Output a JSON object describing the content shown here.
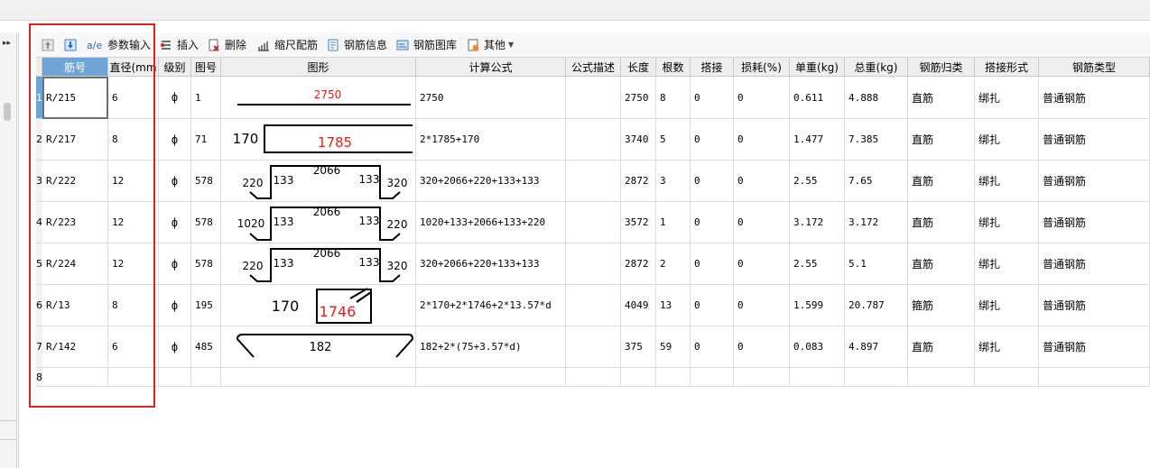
{
  "toolbar": {
    "param_input": "参数输入",
    "insert": "插入",
    "delete": "删除",
    "scale_rebar": "缩尺配筋",
    "rebar_info": "钢筋信息",
    "rebar_library": "钢筋图库",
    "other": "其他"
  },
  "columns": [
    "筋号",
    "直径(mm",
    "级别",
    "图号",
    "图形",
    "计算公式",
    "公式描述",
    "长度",
    "根数",
    "搭接",
    "损耗(%)",
    "单重(kg)",
    "总重(kg)",
    "钢筋归类",
    "搭接形式",
    "钢筋类型"
  ],
  "rows": [
    {
      "n": "1",
      "id": "R/215",
      "dia": "6",
      "grade": "ф",
      "fig": "1",
      "formula": "2750",
      "desc": "",
      "len": "2750",
      "count": "8",
      "lap": "0",
      "loss": "0",
      "unit": "0.611",
      "total": "4.888",
      "cat": "直筋",
      "lapform": "绑扎",
      "type": "普通钢筋",
      "shape_labels": [
        "2750"
      ]
    },
    {
      "n": "2",
      "id": "R/217",
      "dia": "8",
      "grade": "ф",
      "fig": "71",
      "formula": "2*1785+170",
      "desc": "",
      "len": "3740",
      "count": "5",
      "lap": "0",
      "loss": "0",
      "unit": "1.477",
      "total": "7.385",
      "cat": "直筋",
      "lapform": "绑扎",
      "type": "普通钢筋",
      "shape_labels": [
        "170",
        "1785"
      ]
    },
    {
      "n": "3",
      "id": "R/222",
      "dia": "12",
      "grade": "ф",
      "fig": "578",
      "formula": "320+2066+220+133+133",
      "desc": "",
      "len": "2872",
      "count": "3",
      "lap": "0",
      "loss": "0",
      "unit": "2.55",
      "total": "7.65",
      "cat": "直筋",
      "lapform": "绑扎",
      "type": "普通钢筋",
      "shape_labels": [
        "220",
        "133",
        "2066",
        "133",
        "320"
      ]
    },
    {
      "n": "4",
      "id": "R/223",
      "dia": "12",
      "grade": "ф",
      "fig": "578",
      "formula": "1020+133+2066+133+220",
      "desc": "",
      "len": "3572",
      "count": "1",
      "lap": "0",
      "loss": "0",
      "unit": "3.172",
      "total": "3.172",
      "cat": "直筋",
      "lapform": "绑扎",
      "type": "普通钢筋",
      "shape_labels": [
        "1020",
        "133",
        "2066",
        "133",
        "220"
      ]
    },
    {
      "n": "5",
      "id": "R/224",
      "dia": "12",
      "grade": "ф",
      "fig": "578",
      "formula": "320+2066+220+133+133",
      "desc": "",
      "len": "2872",
      "count": "2",
      "lap": "0",
      "loss": "0",
      "unit": "2.55",
      "total": "5.1",
      "cat": "直筋",
      "lapform": "绑扎",
      "type": "普通钢筋",
      "shape_labels": [
        "220",
        "133",
        "2066",
        "133",
        "320"
      ]
    },
    {
      "n": "6",
      "id": "R/13",
      "dia": "8",
      "grade": "ф",
      "fig": "195",
      "formula": "2*170+2*1746+2*13.57*d",
      "desc": "",
      "len": "4049",
      "count": "13",
      "lap": "0",
      "loss": "0",
      "unit": "1.599",
      "total": "20.787",
      "cat": "箍筋",
      "lapform": "绑扎",
      "type": "普通钢筋",
      "shape_labels": [
        "170",
        "1746"
      ]
    },
    {
      "n": "7",
      "id": "R/142",
      "dia": "6",
      "grade": "ф",
      "fig": "485",
      "formula": "182+2*(75+3.57*d)",
      "desc": "",
      "len": "375",
      "count": "59",
      "lap": "0",
      "loss": "0",
      "unit": "0.083",
      "total": "4.897",
      "cat": "直筋",
      "lapform": "绑扎",
      "type": "普通钢筋",
      "shape_labels": [
        "182"
      ]
    },
    {
      "n": "8",
      "id": "",
      "dia": "",
      "grade": "",
      "fig": "",
      "formula": "",
      "desc": "",
      "len": "",
      "count": "",
      "lap": "",
      "loss": "",
      "unit": "",
      "total": "",
      "cat": "",
      "lapform": "",
      "type": "",
      "shape_labels": []
    }
  ],
  "colors": {
    "selected_header": "#6fa4d8",
    "highlight_box": "#e0201c",
    "shape_number_red": "#e0201c"
  }
}
